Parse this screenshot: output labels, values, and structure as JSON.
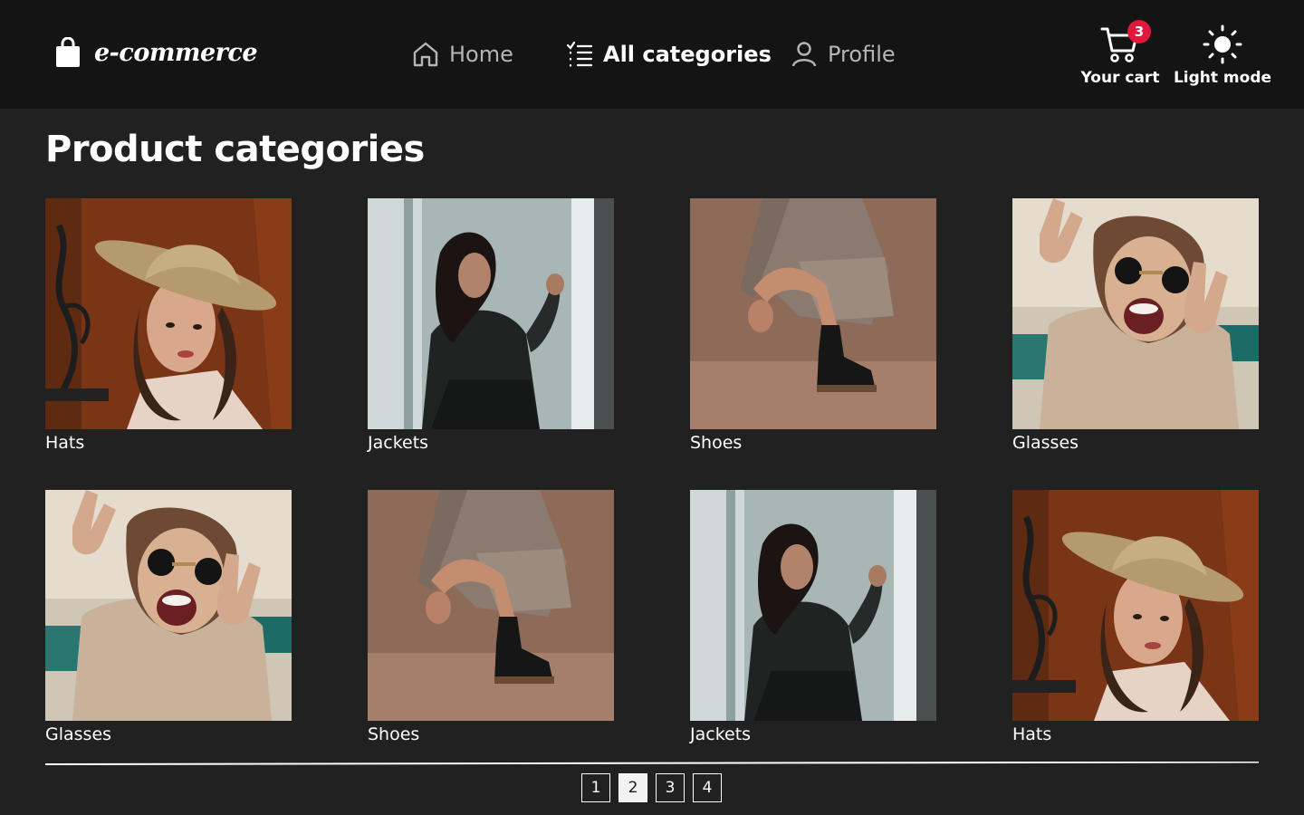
{
  "brand": {
    "name": "e-commerce",
    "icon": "shopping-bag-icon"
  },
  "nav": {
    "home": {
      "label": "Home",
      "icon": "home-icon"
    },
    "categories": {
      "label": "All categories",
      "icon": "list-icon",
      "active": true
    },
    "profile": {
      "label": "Profile",
      "icon": "user-icon"
    }
  },
  "actions": {
    "cart": {
      "label": "Your cart",
      "count": "3",
      "icon": "cart-icon"
    },
    "theme": {
      "label": "Light mode",
      "icon": "sun-icon"
    }
  },
  "main": {
    "title": "Product categories",
    "categories": [
      {
        "name": "Hats",
        "image": "woman in straw hat"
      },
      {
        "name": "Jackets",
        "image": "woman in leather jacket by window"
      },
      {
        "name": "Shoes",
        "image": "woman crouching in boots"
      },
      {
        "name": "Glasses",
        "image": "woman in sunglasses making peace signs"
      },
      {
        "name": "Glasses",
        "image": "woman in sunglasses making peace signs"
      },
      {
        "name": "Shoes",
        "image": "woman crouching in boots"
      },
      {
        "name": "Jackets",
        "image": "woman in leather jacket by window"
      },
      {
        "name": "Hats",
        "image": "woman in straw hat"
      }
    ]
  },
  "pagination": {
    "pages": [
      "1",
      "2",
      "3",
      "4"
    ],
    "current": "2"
  },
  "colors": {
    "background": "#212121",
    "header": "#141414",
    "badge": "#e0183b",
    "muted": "#b5b5b5"
  }
}
